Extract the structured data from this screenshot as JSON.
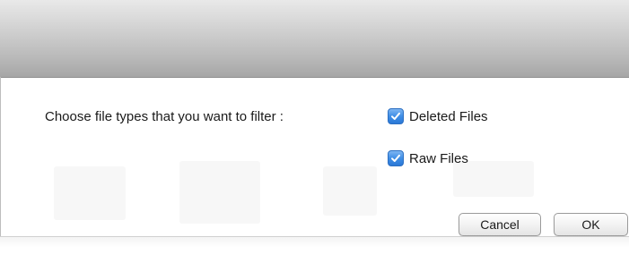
{
  "dialog": {
    "prompt": "Choose file types that you want to filter :",
    "options": [
      {
        "label": "Deleted Files",
        "checked": true,
        "icon": "checkmark-icon"
      },
      {
        "label": "Raw Files",
        "checked": true,
        "icon": "checkmark-icon"
      }
    ],
    "buttons": {
      "cancel_label": "Cancel",
      "ok_label": "OK"
    }
  },
  "colors": {
    "checkbox_accent": "#3f8ee6",
    "titlebar_gray": "#b9b9b9"
  }
}
